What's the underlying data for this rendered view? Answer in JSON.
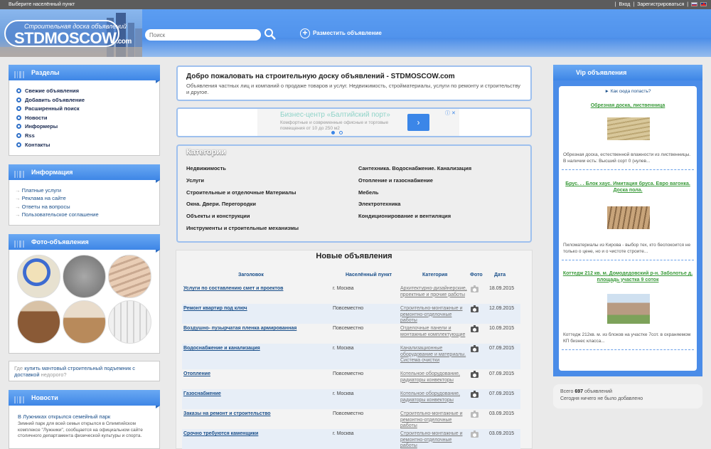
{
  "topbar": {
    "city_label": "Выберите населённый пункт",
    "login": "Вход",
    "register": "Зарегистрироваться",
    "separator": "|"
  },
  "header": {
    "logo_subtitle": "Строительная доска объявлений",
    "logo_main": "STDMOSCOW",
    "logo_tld": ".com",
    "search_placeholder": "Поиск",
    "post_ad": "Разместить объявление"
  },
  "sidebar": {
    "sections_title": "Разделы",
    "sections": [
      "Свежие объявления",
      "Добавить объявление",
      "Расширенный поиск",
      "Новости",
      "Информеры",
      "Rss",
      "Контакты"
    ],
    "info_title": "Информация",
    "info": [
      "Платные услуги",
      "Реклама на сайте",
      "Ответы на вопросы",
      "Пользовательское соглашение"
    ],
    "photo_title": "Фото-объявления",
    "promo_prefix": "Где",
    "promo_link": "купить мачтовый строительный подъемник с доставкой",
    "promo_suffix": "недорого?",
    "news_title": "Новости",
    "news_link": "В Лужниках открылся семейный парк",
    "news_text": "Зимний парк для всей семьи открылся в Олимпийском комплексе \"Лужники\", сообщается на официальном сайте столичного департамента физической культуры и спорта."
  },
  "welcome": {
    "title": "Добро пожаловать на строительную доску объявлений - STDMOSCOW.com",
    "text": "Объявления частных лиц и компаний о продаже товаров и услуг. Недвижимость, стройматериалы, услуги по ремонту и строительству и другое."
  },
  "banner": {
    "title": "Бизнес-центр «Балтийский порт»",
    "text": "Комфортные и современные офисные и торговые помещения от 10 до 250 м2",
    "button": "›",
    "badge": "ⓘ ✕"
  },
  "categories": {
    "title": "Категории",
    "left": [
      "Недвижимость",
      "Услуги",
      "Строительные и отделочные Материалы",
      "Окна. Двери. Перегородки",
      "Объекты и конструкции",
      "Инструменты и строительные механизмы"
    ],
    "right": [
      "Сантехника. Водоснабжение. Канализация",
      "Отопление и газоснабжение",
      "Мебель",
      "Электротехника",
      "Кондиционирование и вентиляция"
    ]
  },
  "ads": {
    "title": "Новые объявления",
    "headers": {
      "title": "Заголовок",
      "place": "Населённый пункт",
      "category": "Категория",
      "photo": "Фото",
      "date": "Дата"
    },
    "rows": [
      {
        "title": "Услуги по составлению смет и проектов",
        "place": "г. Москва",
        "category": "Архитектурно-дизайнерские, проектные и прочие работы",
        "photo": false,
        "date": "18.09.2015"
      },
      {
        "title": "Ремонт квартир под ключ",
        "place": "Повсеместно",
        "category": "Строительно-монтажные и ремонтно-отделочные работы",
        "photo": true,
        "date": "12.09.2015"
      },
      {
        "title": "Воздушно- пузырчатая пленка армированная",
        "place": "Повсеместно",
        "category": "Отделочные панели и монтажные комплектующие",
        "photo": true,
        "date": "10.09.2015"
      },
      {
        "title": "Водоснабжение и канализация",
        "place": "г. Москва",
        "category": "Канализационные оборудование и материалы. Система очистки",
        "photo": true,
        "date": "07.09.2015"
      },
      {
        "title": "Отопление",
        "place": "Повсеместно",
        "category": "Котельное оборудование, радиаторы конвекторы",
        "photo": true,
        "date": "07.09.2015"
      },
      {
        "title": "Газоснабжение",
        "place": "г. Москва",
        "category": "Котельное оборудование, радиаторы конвекторы",
        "photo": true,
        "date": "07.09.2015"
      },
      {
        "title": "Заказы на ремонт и строительство",
        "place": "Повсеместно",
        "category": "Строительно-монтажные и ремонтно-отделочные работы",
        "photo": false,
        "date": "03.09.2015"
      },
      {
        "title": "Срочно требуются каменщики",
        "place": "г. Москва",
        "category": "Строительно-монтажные и ремонтно-отделочные работы",
        "photo": false,
        "date": "03.09.2015"
      }
    ]
  },
  "vip": {
    "title": "Vip объявления",
    "how": "► Как сюда попасть?",
    "items": [
      {
        "title": "Обрезная доска, лиственница",
        "text": "Обрезная доска, естественной влажности из лиственницы. В наличии есть: Высший сорт 0 (нулев..."
      },
      {
        "title": "Брус. . . Блок хаус. Имитация бруса. Евро вагонка. Доска пола.",
        "text": "Пиломатериалы из Кирова - выбор тех, кто беспокоится не только о цене, но и о чистоте строите..."
      },
      {
        "title": "Коттедж 212 кв. м. Домодедовский р-н. Заболотье д. площадь участка 9 соток",
        "text": "Коттедж 212кв. м. из блоков на участке 7сот. в охраняемом КП бизнес класса..."
      }
    ]
  },
  "stats": {
    "total_prefix": "Всего",
    "total_count": "697",
    "total_suffix": "объявлений",
    "today": "Сегодня ничего не было добавлено"
  }
}
